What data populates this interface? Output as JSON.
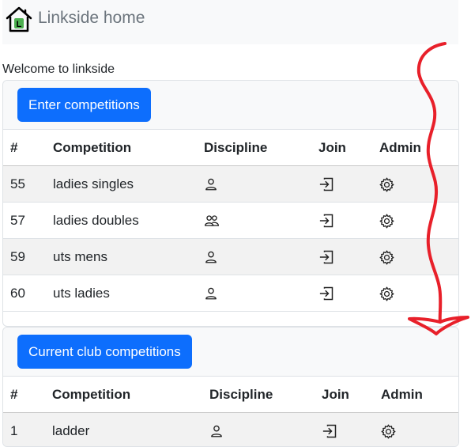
{
  "navbar": {
    "brand_text": "Linkside home",
    "brand_letter": "L"
  },
  "welcome_text": "Welcome to linkside",
  "enter_card": {
    "button_label": "Enter competitions",
    "columns": [
      "#",
      "Competition",
      "Discipline",
      "Join",
      "Admin"
    ],
    "rows": [
      {
        "id": "55",
        "name": "ladies singles",
        "discipline_icon": "person-icon",
        "join_icon": "join-icon",
        "admin_icon": "gear-icon"
      },
      {
        "id": "57",
        "name": "ladies doubles",
        "discipline_icon": "people-icon",
        "join_icon": "join-icon",
        "admin_icon": "gear-icon"
      },
      {
        "id": "59",
        "name": "uts mens",
        "discipline_icon": "person-icon",
        "join_icon": "join-icon",
        "admin_icon": "gear-icon"
      },
      {
        "id": "60",
        "name": "uts ladies",
        "discipline_icon": "person-icon",
        "join_icon": "join-icon",
        "admin_icon": "gear-icon"
      }
    ]
  },
  "club_card": {
    "button_label": "Current club competitions",
    "columns": [
      "#",
      "Competition",
      "Discipline",
      "Join",
      "Admin"
    ],
    "rows": [
      {
        "id": "1",
        "name": "ladder",
        "discipline_icon": "person-icon",
        "join_icon": "join-icon",
        "admin_icon": "gear-icon"
      }
    ]
  },
  "colors": {
    "primary": "#0d6efd",
    "brand_green": "#4caf50",
    "annotation_red": "#e8202a"
  }
}
